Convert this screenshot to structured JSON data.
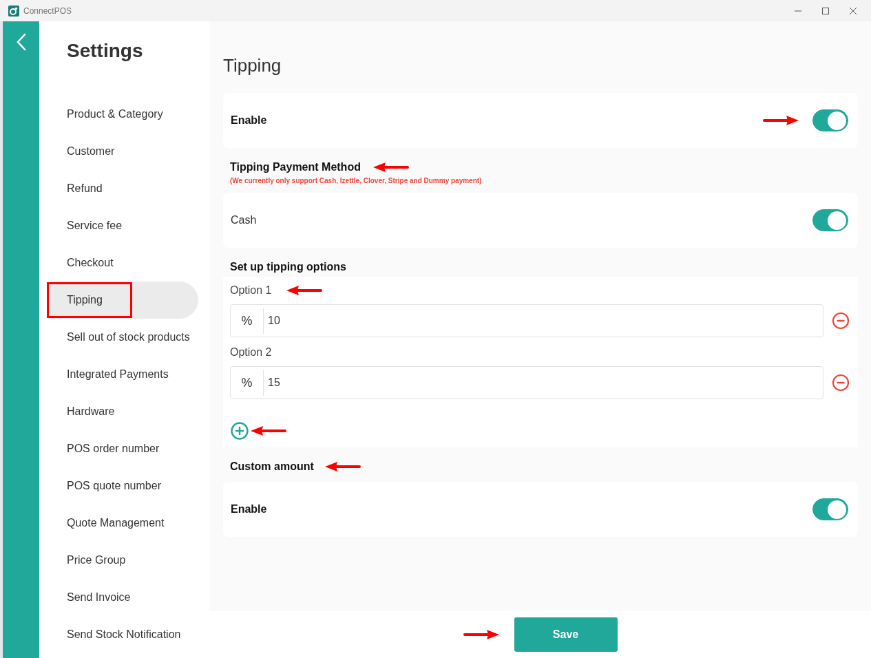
{
  "window": {
    "title": "ConnectPOS"
  },
  "sidebar": {
    "title": "Settings",
    "items": [
      {
        "label": "Product & Category",
        "selected": false,
        "annotated": false
      },
      {
        "label": "Customer",
        "selected": false,
        "annotated": false
      },
      {
        "label": "Refund",
        "selected": false,
        "annotated": false
      },
      {
        "label": "Service fee",
        "selected": false,
        "annotated": false
      },
      {
        "label": "Checkout",
        "selected": false,
        "annotated": false
      },
      {
        "label": "Tipping",
        "selected": true,
        "annotated": true
      },
      {
        "label": "Sell out of stock products",
        "selected": false,
        "annotated": false
      },
      {
        "label": "Integrated Payments",
        "selected": false,
        "annotated": false
      },
      {
        "label": "Hardware",
        "selected": false,
        "annotated": false
      },
      {
        "label": "POS order number",
        "selected": false,
        "annotated": false
      },
      {
        "label": "POS quote number",
        "selected": false,
        "annotated": false
      },
      {
        "label": "Quote Management",
        "selected": false,
        "annotated": false
      },
      {
        "label": "Price Group",
        "selected": false,
        "annotated": false
      },
      {
        "label": "Send Invoice",
        "selected": false,
        "annotated": false
      },
      {
        "label": "Send Stock Notification",
        "selected": false,
        "annotated": false
      }
    ]
  },
  "page_title": "Tipping",
  "enable": {
    "label": "Enable",
    "on": true
  },
  "payment_method": {
    "heading": "Tipping Payment Method",
    "note": "(We currently only support Cash, Izettle, Clover, Stripe and Dummy payment)",
    "methods": [
      {
        "label": "Cash",
        "on": true
      }
    ]
  },
  "tipping_options": {
    "heading": "Set up tipping options",
    "options": [
      {
        "label": "Option 1",
        "unit": "%",
        "value": "10"
      },
      {
        "label": "Option 2",
        "unit": "%",
        "value": "15"
      }
    ]
  },
  "custom_amount": {
    "heading": "Custom amount",
    "label": "Enable",
    "on": true
  },
  "save_button": "Save"
}
